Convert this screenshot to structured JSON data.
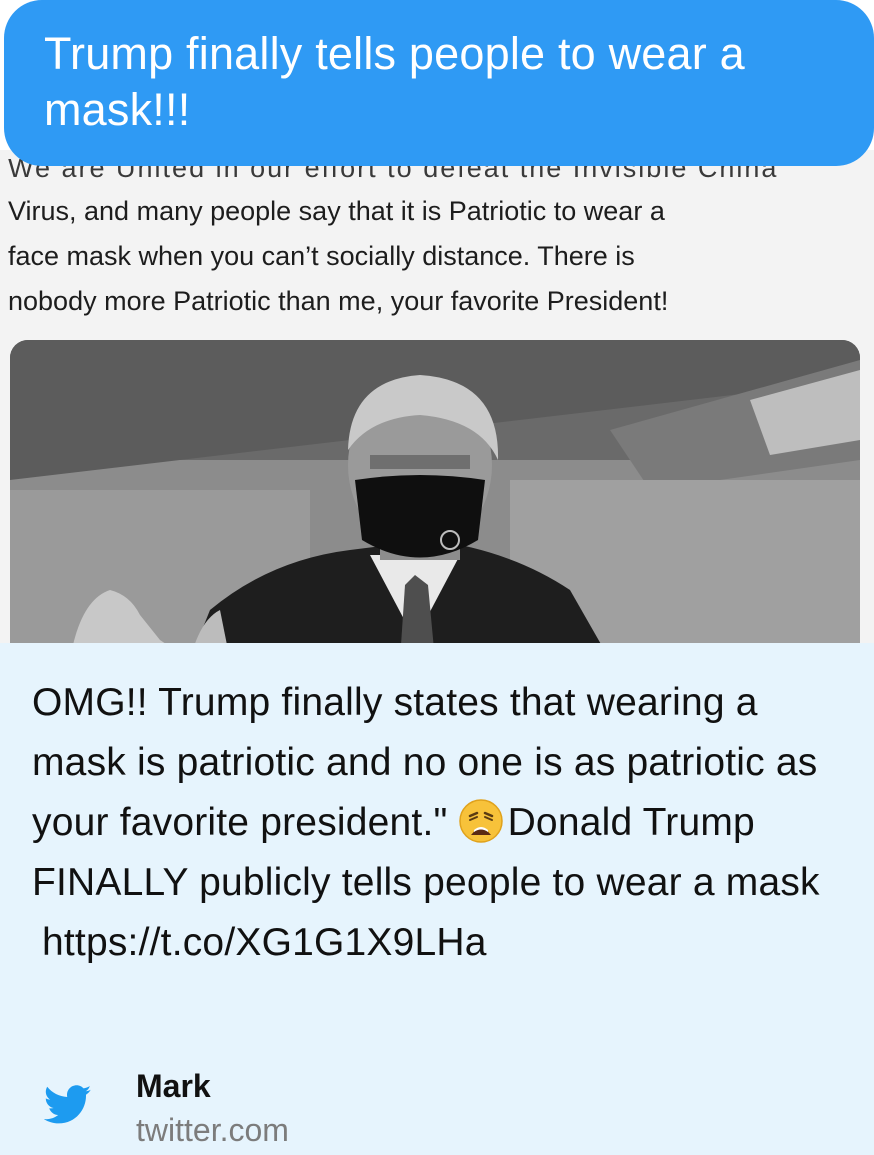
{
  "sent_message": {
    "text": "Trump finally tells people to wear a mask!!!"
  },
  "tweet_screenshot": {
    "cut_line": "We are United in our effort to defeat the Invisible China",
    "lines": [
      "Virus, and many people say that it is Patriotic to wear a",
      "face mask when you can’t socially distance. There is",
      "nobody more Patriotic than me, your favorite President!"
    ],
    "photo_icon": "photo-of-man-in-black-face-mask"
  },
  "link_preview": {
    "description_before_emoji": "OMG!! Trump finally states that wearing a mask is patriotic and no one is as patriotic as your favorite president.\"",
    "emoji_icon": "weary-face-emoji",
    "description_after_emoji": "Donald Trump FINALLY publicly tells people to wear a mask",
    "link": "https://t.co/XG1G1X9LHa",
    "source_name": "Mark",
    "source_domain": "twitter.com",
    "source_icon": "twitter-bird-icon",
    "colors": {
      "bubble": "#2f9af4",
      "preview_background": "#e6f4fd",
      "twitter_blue": "#1d9bf0"
    }
  }
}
